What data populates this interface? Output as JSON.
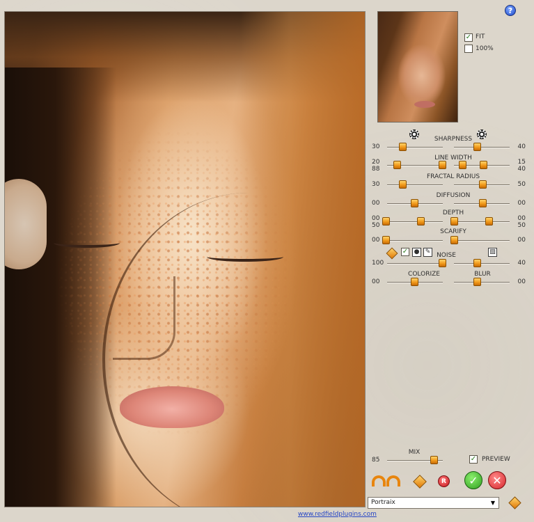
{
  "preview": {
    "fit_label": "FIT",
    "fit_checked": true,
    "hundred_label": "100%",
    "hundred_checked": false
  },
  "help": {
    "icon": "question-icon",
    "glyph": "?"
  },
  "sliders": {
    "sharpness": {
      "title": "SHARPNESS",
      "left": "30",
      "right": "40"
    },
    "line_width": {
      "title": "LINE WIDTH",
      "left_top": "20",
      "left_bottom": "88",
      "right_top": "15",
      "right_bottom": "40"
    },
    "fractal_radius": {
      "title": "FRACTAL RADIUS",
      "left": "30",
      "right": "50"
    },
    "diffusion": {
      "title": "DIFFUSION",
      "left": "00",
      "right": "00"
    },
    "depth": {
      "title": "DEPTH",
      "left_top": "00",
      "left_bottom": "50",
      "right_top": "00",
      "right_bottom": "50"
    },
    "scarify": {
      "title": "SCARIFY",
      "left": "00",
      "right": "00"
    },
    "noise": {
      "title": "NOISE",
      "left": "100",
      "right": "40"
    },
    "colorize": {
      "title": "COLORIZE",
      "left": "00"
    },
    "blur": {
      "title": "BLUR",
      "right": "00"
    }
  },
  "mix": {
    "title": "MIX",
    "value": "85"
  },
  "preview_toggle": {
    "label": "PREVIEW",
    "checked": true
  },
  "preset": {
    "selected": "Portraix"
  },
  "footer": {
    "url": "www.redfieldplugins.com"
  },
  "colors": {
    "accent": "#f19a1b",
    "ok": "#2f9e1f",
    "cancel": "#d6262b",
    "link": "#2545c5"
  }
}
